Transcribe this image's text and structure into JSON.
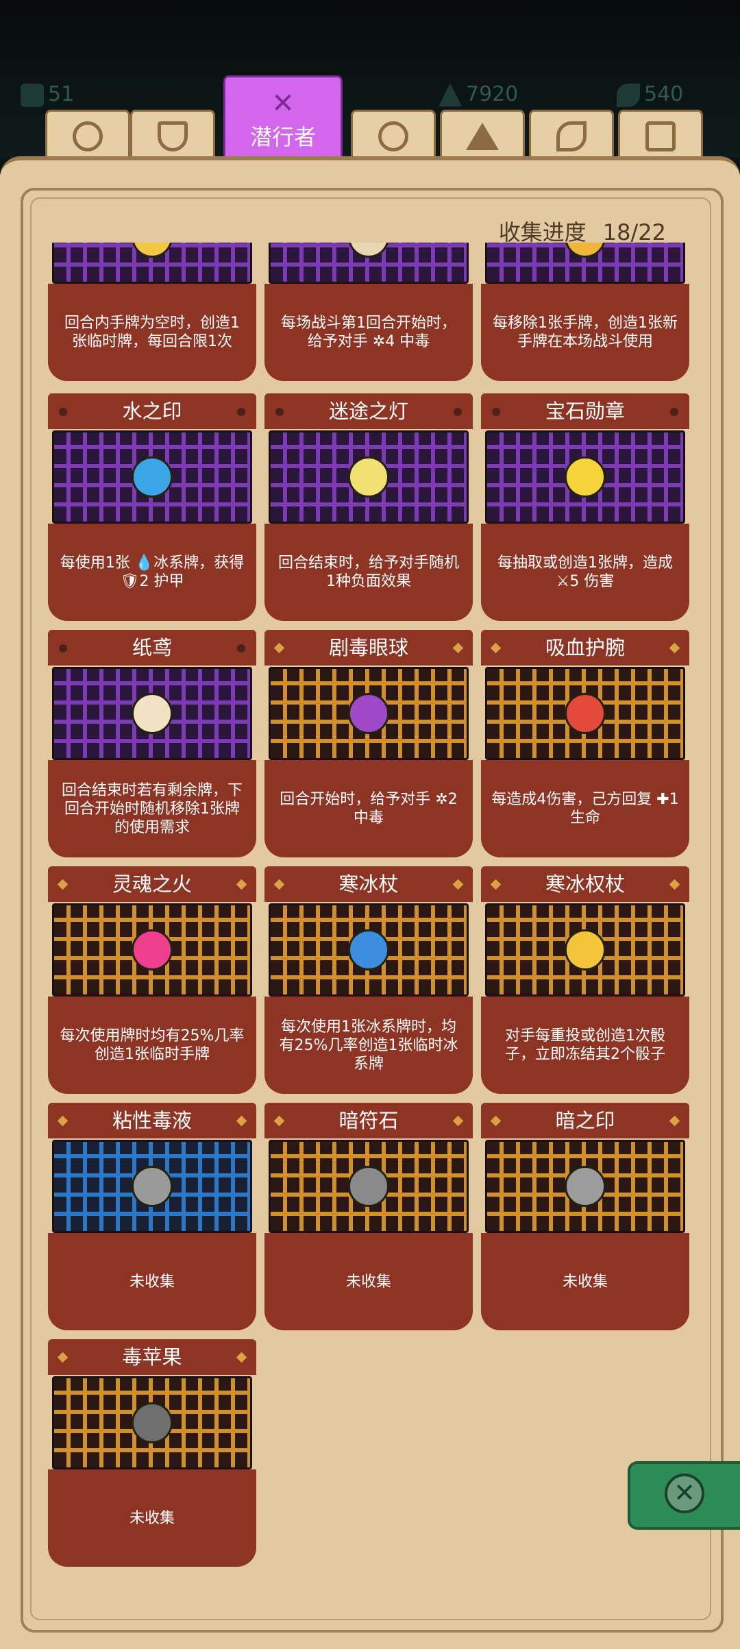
{
  "status": {
    "resource_1": "51",
    "resource_2": "7920",
    "resource_3": "540"
  },
  "tabs": [
    {
      "name": "tab-1",
      "icon": "clover-icon"
    },
    {
      "name": "tab-2",
      "icon": "shield-icon"
    },
    {
      "name": "tab-3",
      "icon": "cross-blades-icon",
      "label": "潜行者",
      "active": true
    },
    {
      "name": "tab-4",
      "icon": "swirl-icon"
    },
    {
      "name": "tab-5",
      "icon": "triangle-icon"
    },
    {
      "name": "tab-6",
      "icon": "eye-icon"
    },
    {
      "name": "tab-7",
      "icon": "bag-icon"
    }
  ],
  "progress": {
    "label": "收集进度",
    "value": "18/22"
  },
  "cards": [
    {
      "title": "",
      "desc": "回合内手牌为空时，创造1张临时牌，每回合限1次",
      "maze": "p",
      "item_color": "#f2c744"
    },
    {
      "title": "",
      "desc": "每场战斗第1回合开始时，给予对手 ✲4 中毒",
      "maze": "p",
      "item_color": "#e7d7b3"
    },
    {
      "title": "",
      "desc": "每移除1张手牌，创造1张新手牌在本场战斗使用",
      "maze": "p",
      "item_color": "#f0b63b"
    },
    {
      "title": "水之印",
      "desc": "每使用1张 💧冰系牌，获得 🛡2 护甲",
      "maze": "p",
      "item_color": "#3aa6e8"
    },
    {
      "title": "迷途之灯",
      "desc": "回合结束时，给予对手随机1种负面效果",
      "maze": "p",
      "item_color": "#f3e074"
    },
    {
      "title": "宝石勋章",
      "desc": "每抽取或创造1张牌，造成 ⚔5 伤害",
      "maze": "p",
      "item_color": "#f5d53a"
    },
    {
      "title": "纸鸢",
      "desc": "回合结束时若有剩余牌，下回合开始时随机移除1张牌的使用需求",
      "maze": "p",
      "item_color": "#f1e2c4"
    },
    {
      "title": "剧毒眼球",
      "desc": "回合开始时，给予对手 ✲2 中毒",
      "maze": "o",
      "item_color": "#a14ac9"
    },
    {
      "title": "吸血护腕",
      "desc": "每造成4伤害，己方回复 ✚1 生命",
      "maze": "o",
      "item_color": "#e34a3a"
    },
    {
      "title": "灵魂之火",
      "desc": "每次使用牌时均有25%几率创造1张临时手牌",
      "maze": "o",
      "item_color": "#ee3f8e"
    },
    {
      "title": "寒冰杖",
      "desc": "每次使用1张冰系牌时，均有25%几率创造1张临时冰系牌",
      "maze": "o",
      "item_color": "#3e8ee0"
    },
    {
      "title": "寒冰权杖",
      "desc": "对手每重投或创造1次骰子，立即冻结其2个骰子",
      "maze": "o",
      "item_color": "#f4c43a"
    },
    {
      "title": "粘性毒液",
      "desc": "未收集",
      "maze": "b",
      "item_color": "#9a9a9a"
    },
    {
      "title": "暗符石",
      "desc": "未收集",
      "maze": "o",
      "item_color": "#8a8a8a"
    },
    {
      "title": "暗之印",
      "desc": "未收集",
      "maze": "o",
      "item_color": "#9c9c9c"
    },
    {
      "title": "毒苹果",
      "desc": "未收集",
      "maze": "o",
      "item_color": "#6f6f6f"
    }
  ]
}
